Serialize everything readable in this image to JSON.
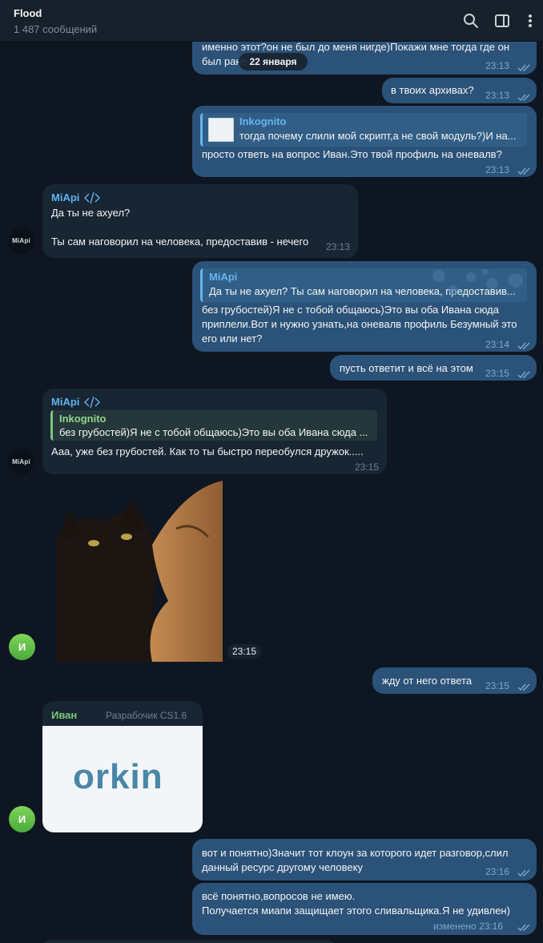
{
  "header": {
    "title": "Flood",
    "subtitle": "1 487 сообщений",
    "icons": [
      "search-icon",
      "sidebar-toggle-icon",
      "more-vertical-icon"
    ]
  },
  "date_pill": "22 января",
  "messages": {
    "m1": {
      "text": "именно этот?он не был до меня нигде)Покажи мне тогда где он\nбыл ране",
      "time": "23:13"
    },
    "m2": {
      "text": "в твоих архивах?",
      "time": "23:13"
    },
    "m3": {
      "reply_name": "Inkognito",
      "reply_text": "тогда почему слили мой скрипт,а не свой модуль?)И на...",
      "text": "просто ответь на вопрос  Иван.Это твой профиль на оневалв?",
      "time": "23:13"
    },
    "m4": {
      "sender": "MiApi",
      "text": "Да ты не ахуел?\n\nТы сам наговорил на человека, предоставив - нечего",
      "time": "23:13",
      "avatar": "MiApi"
    },
    "m5": {
      "reply_name": "MiApi",
      "reply_text": "Да ты не ахуел?  Ты сам наговорил на человека, предоставив...",
      "text": "без грубостей)Я не с тобой общаюсь)Это вы оба Ивана сюда\nприплели.Вот и нужно узнать,на оневалв профиль Безумный это\nего или нет?",
      "time": "23:14"
    },
    "m6": {
      "text": "пусть ответит и всё на этом",
      "time": "23:15"
    },
    "m7": {
      "sender": "MiApi",
      "reply_name": "Inkognito",
      "reply_text": "без грубостей)Я не с тобой общаюсь)Это вы оба Ивана сюда ...",
      "text": "Ааа, уже без грубостей. Как то ты быстро переобулся дружок.....",
      "time": "23:15",
      "avatar": "MiApi"
    },
    "m8": {
      "time": "23:15",
      "avatar": "И"
    },
    "m9": {
      "text": "жду от него ответа",
      "time": "23:15"
    },
    "m10": {
      "sender": "Иван",
      "rank": "Разрабочик CS1.6",
      "image_text": "orkin",
      "avatar": "И"
    },
    "m11": {
      "text": "вот и понятно)Значит тот клоун за которого идет разговор,слил\nданный ресурс другому человеку",
      "time": "23:16"
    },
    "m12": {
      "text": "всё понятно,вопросов не имею.\nПолучается миапи защищает этого сливальщика.Я не удивлен)",
      "time": "изменено 23:16"
    }
  },
  "colors": {
    "background": "#0e1621",
    "header": "#17212b",
    "outgoing": "#2b5278",
    "incoming": "#182533",
    "accent": "#64b5ef",
    "green_name": "#7ec77a"
  }
}
